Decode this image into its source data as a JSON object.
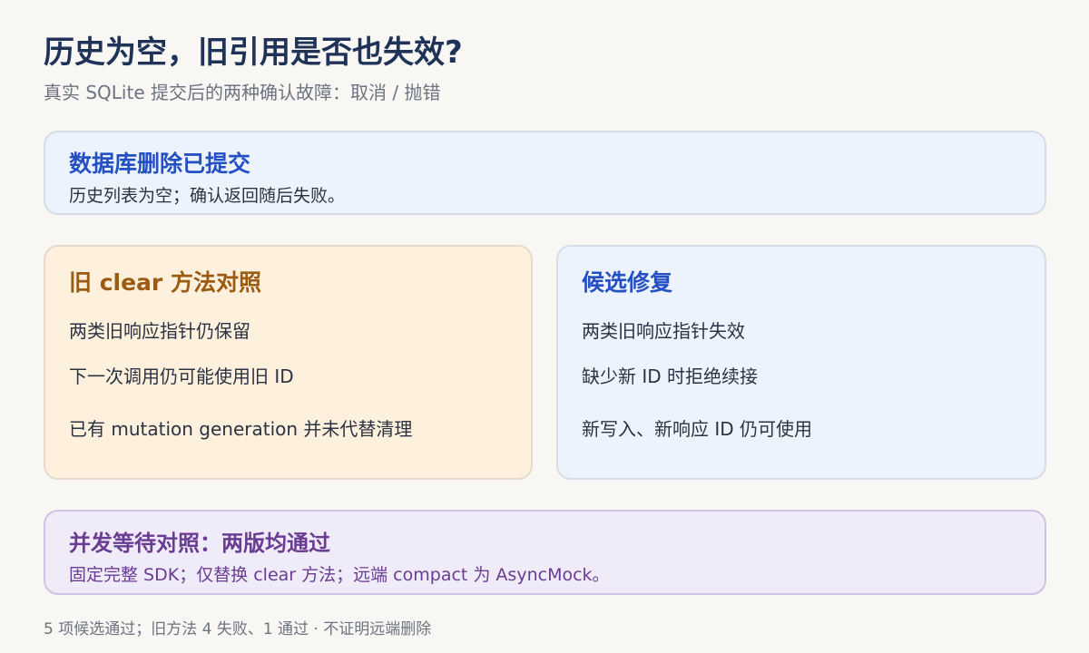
{
  "header": {
    "title": "历史为空，旧引用是否也失效?",
    "subtitle": "真实 SQLite 提交后的两种确认故障：取消 / 抛错"
  },
  "summary_card": {
    "title": "数据库删除已提交",
    "body": "历史列表为空；确认返回随后失败。"
  },
  "old_card": {
    "title": "旧 clear 方法对照",
    "items": [
      "两类旧响应指针仍保留",
      "下一次调用仍可能使用旧 ID",
      "已有 mutation generation 并未代替清理"
    ]
  },
  "fix_card": {
    "title": "候选修复",
    "items": [
      "两类旧响应指针失效",
      "缺少新 ID 时拒绝续接",
      "新写入、新响应 ID 仍可使用"
    ]
  },
  "concurrency_card": {
    "title": "并发等待对照：两版均通过",
    "body": "固定完整 SDK；仅替换 clear 方法；远端 compact 为 AsyncMock。"
  },
  "footer": {
    "text": "5 项候选通过；旧方法 4 失败、1 通过 · 不证明远端删除"
  },
  "colors": {
    "background": "#f8f7f3",
    "title": "#1f3258",
    "blue_accent": "#2450c4",
    "orange_accent": "#9b5b12",
    "purple_accent": "#6a3c92",
    "blue_card": "#edf3fd",
    "orange_card": "#fdf0dc",
    "purple_card": "#efebf8"
  }
}
